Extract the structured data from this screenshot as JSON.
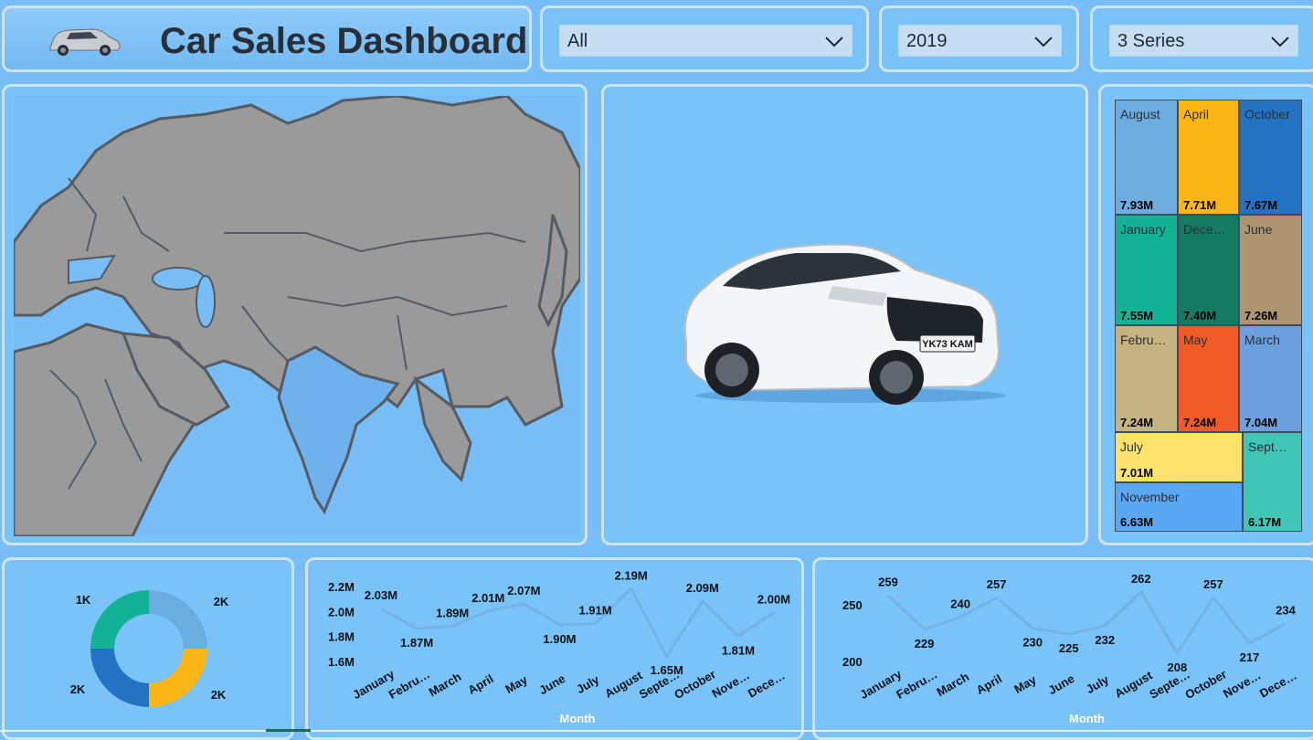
{
  "header": {
    "title": "Car Sales Dashboard",
    "car_icon": "car-thumbnail"
  },
  "slicers": [
    {
      "name": "region",
      "value": "All"
    },
    {
      "name": "year",
      "value": "2019"
    },
    {
      "name": "model",
      "value": "3 Series"
    }
  ],
  "map": {
    "highlighted_country": "India",
    "land_color": "#9a9a9a",
    "highlight_color": "#6fb1ec",
    "border_color": "#555b63"
  },
  "image": {
    "car_plate": "YK73 KAM",
    "description_icon": "car-photo"
  },
  "treemap": {
    "tiles": [
      {
        "label": "August",
        "value": "7.93M",
        "color": "#6eace0"
      },
      {
        "label": "April",
        "value": "7.71M",
        "color": "#fbb514"
      },
      {
        "label": "October",
        "value": "7.67M",
        "color": "#2373c2"
      },
      {
        "label": "January",
        "value": "7.55M",
        "color": "#13b296"
      },
      {
        "label": "Dece…",
        "value": "7.40M",
        "color": "#147a63"
      },
      {
        "label": "June",
        "value": "7.26M",
        "color": "#ad9572"
      },
      {
        "label": "Febru…",
        "value": "7.24M",
        "color": "#c6b382"
      },
      {
        "label": "May",
        "value": "7.24M",
        "color": "#f05a27"
      },
      {
        "label": "March",
        "value": "7.04M",
        "color": "#6b9fde"
      },
      {
        "label": "July",
        "value": "7.01M",
        "color": "#fde26b"
      },
      {
        "label": "November",
        "value": "6.63M",
        "color": "#5aa8f4"
      },
      {
        "label": "Sept…",
        "value": "6.17M",
        "color": "#40c5b6"
      }
    ]
  },
  "donut": {
    "slices": [
      {
        "label": "2K",
        "value": 0.25,
        "color": "#6aaedf"
      },
      {
        "label": "2K",
        "value": 0.25,
        "color": "#fbb514"
      },
      {
        "label": "2K",
        "value": 0.25,
        "color": "#2373c2"
      },
      {
        "label": "1K",
        "value": 0.25,
        "color": "#13b296"
      }
    ]
  },
  "chart_data": [
    {
      "type": "line",
      "categories": [
        "January",
        "Febru…",
        "March",
        "April",
        "May",
        "June",
        "July",
        "August",
        "Septe…",
        "October",
        "Nove…",
        "Dece…"
      ],
      "values": [
        2.03,
        1.87,
        1.89,
        2.01,
        2.07,
        1.9,
        1.91,
        2.19,
        1.65,
        2.09,
        1.81,
        2.0
      ],
      "data_labels": [
        "2.03M",
        "1.87M",
        "1.89M",
        "2.01M",
        "2.07M",
        "1.90M",
        "1.91M",
        "2.19M",
        "1.65M",
        "2.09M",
        "1.81M",
        "2.00M"
      ],
      "yticks": [
        "1.6M",
        "1.8M",
        "2.0M",
        "2.2M"
      ],
      "ylim": [
        1.6,
        2.2
      ],
      "xlabel": "Month",
      "ylabel": "",
      "line_color": "#74b3e6"
    },
    {
      "type": "line",
      "categories": [
        "January",
        "Febru…",
        "March",
        "April",
        "May",
        "June",
        "July",
        "August",
        "Septe…",
        "October",
        "Nove…",
        "Dece…"
      ],
      "values": [
        259,
        229,
        240,
        257,
        230,
        225,
        232,
        262,
        208,
        257,
        217,
        234
      ],
      "data_labels": [
        "259",
        "229",
        "240",
        "257",
        "230",
        "225",
        "232",
        "262",
        "208",
        "257",
        "217",
        "234"
      ],
      "yticks": [
        "200",
        "250"
      ],
      "ylim": [
        200,
        270
      ],
      "xlabel": "Month",
      "ylabel": "",
      "line_color": "#74b3e6"
    }
  ]
}
